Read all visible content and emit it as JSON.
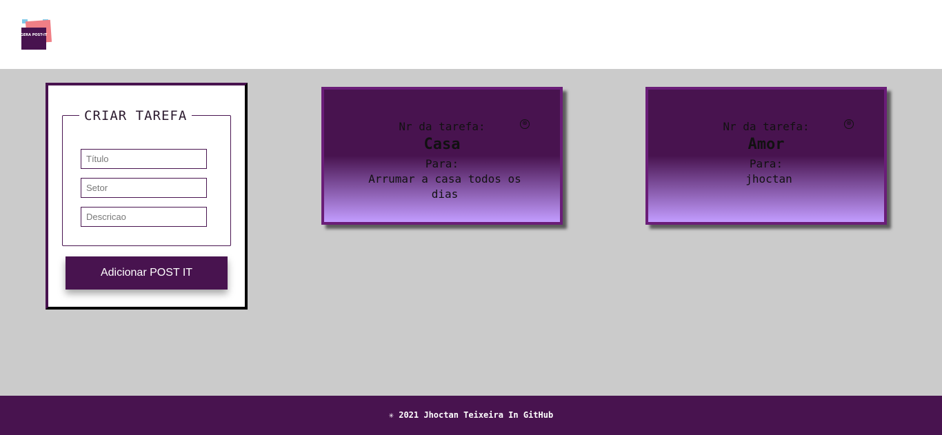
{
  "header": {
    "logo_text": "GERA POST-IT"
  },
  "form": {
    "legend": "CRIAR TAREFA",
    "title_placeholder": "Título",
    "sector_placeholder": "Setor",
    "description_placeholder": "Descricao",
    "submit_label": "Adicionar POST IT"
  },
  "postits": [
    {
      "nr_label": "Nr da tarefa:",
      "title": "Casa",
      "para_label": "Para:",
      "description": "Arrumar a casa todos os dias",
      "close_icon": "⊗"
    },
    {
      "nr_label": "Nr da tarefa:",
      "title": "Amor",
      "para_label": "Para:",
      "description": "jhoctan",
      "close_icon": "⊗"
    }
  ],
  "footer": {
    "text": "✳ 2021 Jhoctan Teixeira In GitHub"
  },
  "colors": {
    "primary": "#48134f",
    "postit_bottom": "#c29cff",
    "background": "#cbcbcb"
  }
}
